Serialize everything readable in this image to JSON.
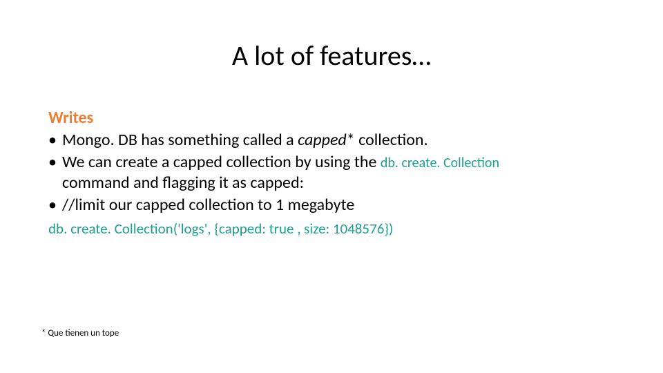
{
  "title": "A lot of features…",
  "section_heading": "Writes",
  "bullets": {
    "b1_pre": "Mongo. DB has something called a ",
    "b1_em": "capped",
    "b1_star": "*",
    "b1_post": " collection.",
    "b2_pre": "We can create a capped collection by using the ",
    "b2_code": "db. create. Collection",
    "b2_post_line2": "command and flagging it as capped:",
    "b3": "//limit our capped collection to 1 megabyte"
  },
  "code_line": "db. create. Collection('logs', {capped: true , size: 1048576})",
  "footnote": "* Que tienen un tope"
}
